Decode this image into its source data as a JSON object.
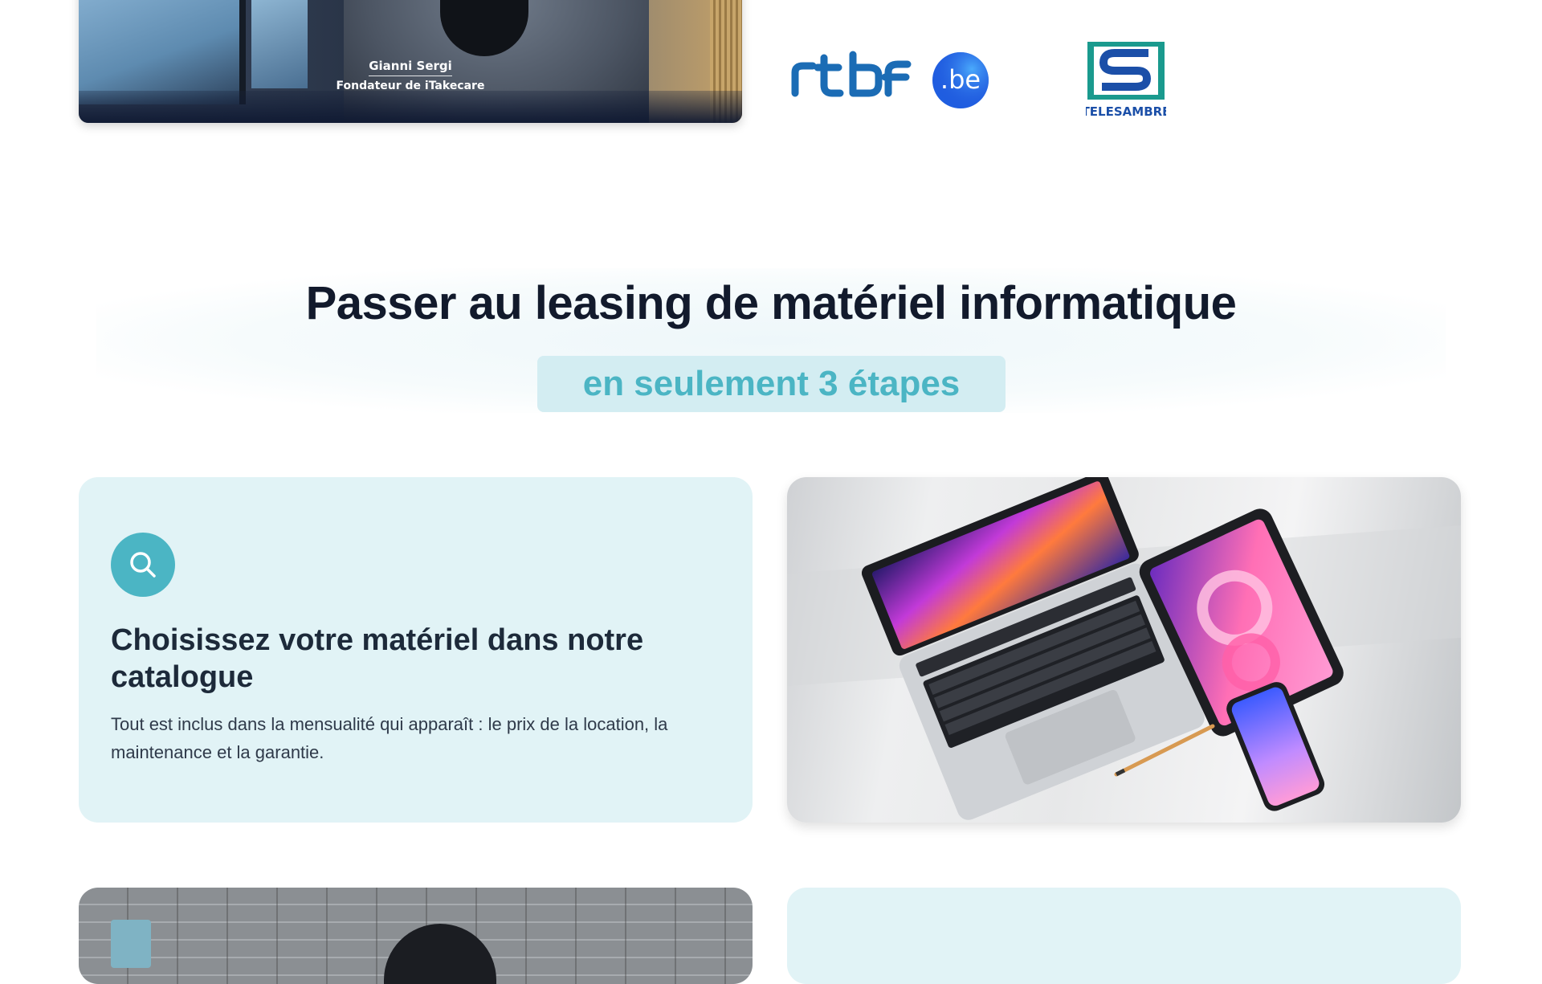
{
  "video": {
    "person_name": "Gianni Sergi",
    "person_role": "Fondateur de iTakecare"
  },
  "press_logos": [
    {
      "name": "rtbf.be",
      "icon": "rtbf-logo",
      "color": "#1b6cb5"
    },
    {
      "name": "TELESAMBRE",
      "icon": "telesambre-logo",
      "color": "#1a9a8e"
    }
  ],
  "section": {
    "title": "Passer au leasing de matériel informatique",
    "subtitle": "en seulement 3 étapes"
  },
  "steps": [
    {
      "icon": "search-icon",
      "title": "Choisissez votre matériel dans notre catalogue",
      "text": "Tout est inclus dans la mensualité qui apparaît : le prix de la location, la maintenance et la garantie."
    }
  ],
  "colors": {
    "accent": "#4bb5c4",
    "card_background": "#e1f3f6",
    "subtitle_background": "#d3edf2",
    "heading": "#121a2c"
  }
}
